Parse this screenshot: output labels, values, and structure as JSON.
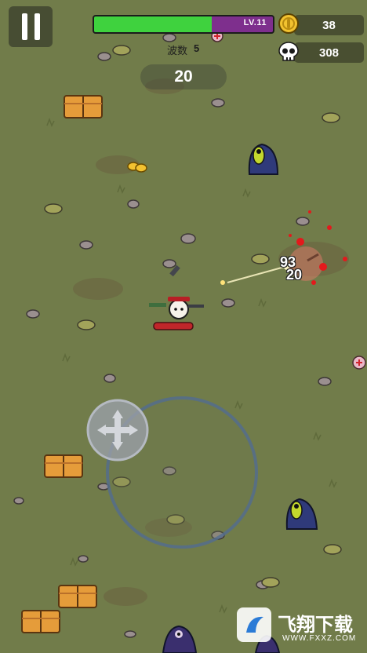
{
  "hud": {
    "level_label": "LV.11",
    "xp_progress": 0.66,
    "gold_count": "38",
    "kill_count": "308",
    "wave_label": "波数",
    "wave_number": "5",
    "timer": "20"
  },
  "combat": {
    "damage_numbers": [
      "93",
      "20"
    ]
  },
  "watermark": {
    "text": "飞翔下载",
    "sub": "WWW.FXXZ.COM"
  },
  "icons": [
    "pause-icon",
    "gold-coin-icon",
    "skull-icon",
    "joystick-icon"
  ],
  "colors": {
    "ground": "#717c4a",
    "xp_fill": "#3fd23e",
    "xp_empty": "#7e2f8d",
    "health": "#c0262a",
    "enemy": "#2f3a7a"
  }
}
